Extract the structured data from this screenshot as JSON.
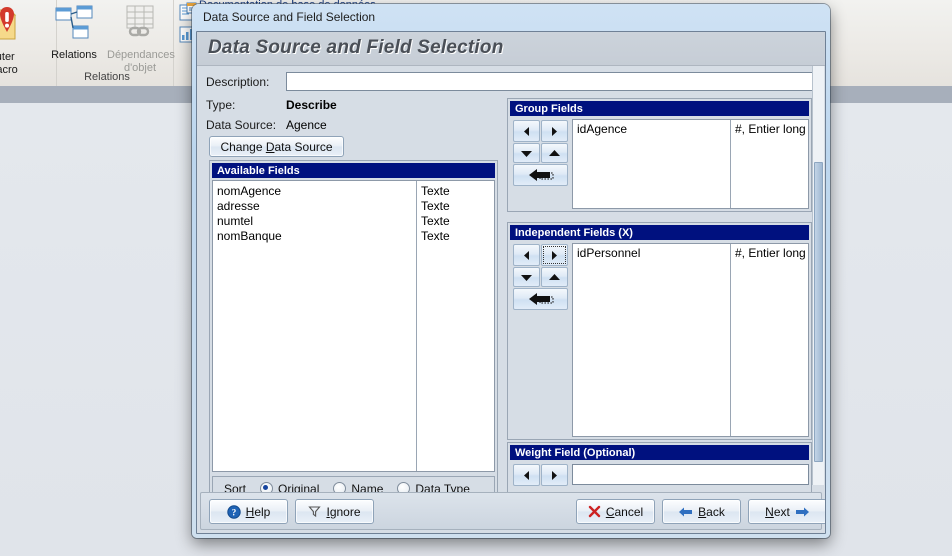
{
  "background": {
    "app_tab_title": "Documentation de base de données",
    "ribbon_groups": [
      {
        "label": "",
        "buttons": [
          {
            "label_line1": "cuter",
            "label_line2": "macro",
            "icon": "run-macro-icon",
            "disabled": false
          }
        ]
      },
      {
        "label": "Relations",
        "buttons": [
          {
            "label_line1": "Relations",
            "label_line2": "",
            "icon": "relations-icon",
            "disabled": false
          },
          {
            "label_line1": "Dépendances",
            "label_line2": "d'objet",
            "icon": "object-dependencies-icon",
            "disabled": true
          }
        ]
      }
    ]
  },
  "dialog": {
    "titlebar": "Data Source and Field Selection",
    "heading": "Data Source and Field Selection",
    "description": {
      "label": "Description:",
      "value": "",
      "placeholder": ""
    },
    "type": {
      "label": "Type:",
      "value": "Describe"
    },
    "data_source": {
      "label": "Data Source:",
      "value": "Agence"
    },
    "change_data_source_button": "Change Data Source",
    "available_fields": {
      "title": "Available Fields",
      "rows": [
        {
          "name": "nomAgence",
          "type": "Texte"
        },
        {
          "name": "adresse",
          "type": "Texte"
        },
        {
          "name": "numtel",
          "type": "Texte"
        },
        {
          "name": "nomBanque",
          "type": "Texte"
        }
      ]
    },
    "sort": {
      "label": "Sort",
      "options": [
        {
          "label": "Original",
          "selected": true
        },
        {
          "label": "Name",
          "selected": false
        },
        {
          "label": "Data Type",
          "selected": false
        }
      ]
    },
    "group_fields": {
      "title": "Group Fields",
      "rows": [
        {
          "name": "idAgence",
          "type": "#, Entier long"
        }
      ]
    },
    "independent_fields": {
      "title": "Independent Fields (X)",
      "rows": [
        {
          "name": "idPersonnel",
          "type": "#, Entier long"
        }
      ]
    },
    "weight_field": {
      "title": "Weight Field (Optional)",
      "value": "",
      "placeholder": ""
    },
    "arrow_buttons": {
      "move_left": "◀",
      "move_right": "▶",
      "move_down": "▼",
      "move_up": "▲",
      "remove_all": "remove-all-arrow"
    },
    "footer": {
      "help": "Help",
      "ignore": "Ignore",
      "cancel": "Cancel",
      "back": "Back",
      "next": "Next"
    }
  },
  "colors": {
    "panel_title_bg": "#00117f",
    "dialog_frame": "#bcd6ee",
    "dialog_body": "#d6dde5",
    "cancel_x": "#cc2222",
    "back_arrow": "#2f6fc0",
    "help_icon": "#1f63b5"
  }
}
